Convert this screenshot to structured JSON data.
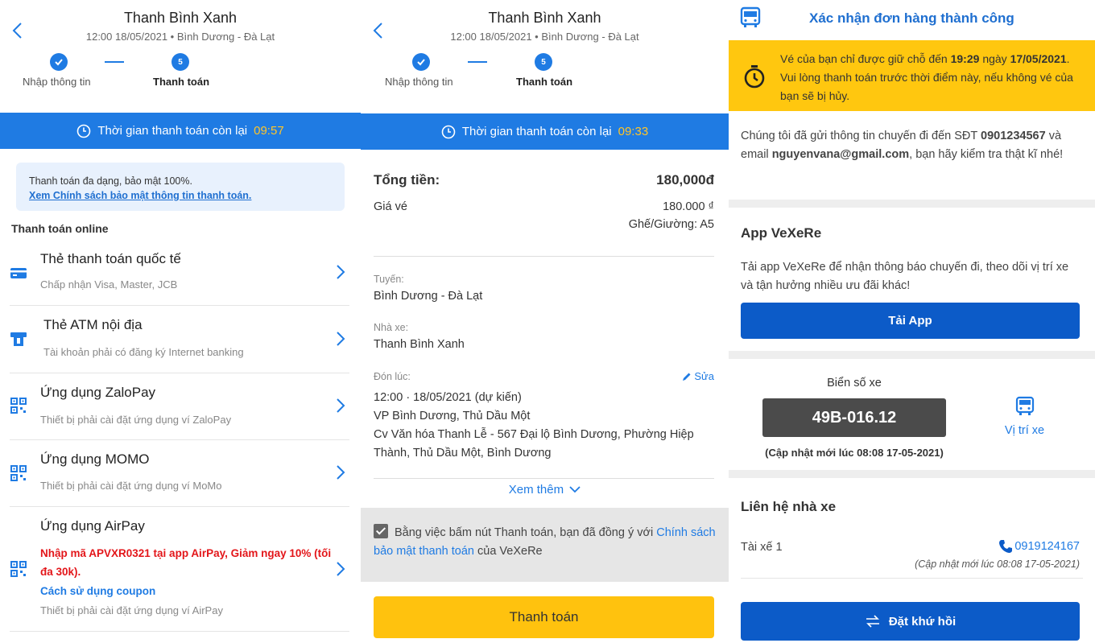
{
  "panel1": {
    "header": {
      "title": "Thanh Bình Xanh",
      "subtitle": "12:00 18/05/2021 • Bình Dương - Đà Lạt",
      "step1_label": "Nhập thông tin",
      "step2_label": "Thanh toán",
      "step2_number": "5"
    },
    "timer": {
      "label": "Thời gian thanh toán còn lại",
      "value": "09:57"
    },
    "info": {
      "text": "Thanh toán đa dạng, bảo mật 100%.",
      "link": "Xem Chính sách bảo mật thông tin thanh toán."
    },
    "section_title": "Thanh toán online",
    "methods": [
      {
        "name": "Thẻ thanh toán quốc tế",
        "desc": "Chấp nhận Visa, Master, JCB"
      },
      {
        "name": "Thẻ ATM nội địa",
        "desc": "Tài khoản phải có đăng ký Internet banking"
      },
      {
        "name": "Ứng dụng ZaloPay",
        "desc": "Thiết bị phải cài đặt ứng dụng ví ZaloPay"
      },
      {
        "name": "Ứng dụng MOMO",
        "desc": "Thiết bị phải cài đặt ứng dụng ví MoMo"
      },
      {
        "name": "Ứng dụng AirPay",
        "promo": "Nhập mã APVXR0321 tại app AirPay, Giảm ngay 10% (tối đa 30k).",
        "howto": "Cách sử dụng coupon",
        "desc": "Thiết bị phải cài đặt ứng dụng ví AirPay"
      }
    ]
  },
  "panel2": {
    "header": {
      "title": "Thanh Bình Xanh",
      "subtitle": "12:00 18/05/2021 • Bình Dương - Đà Lạt",
      "step1_label": "Nhập thông tin",
      "step2_label": "Thanh toán",
      "step2_number": "5"
    },
    "timer": {
      "label": "Thời gian thanh toán còn lại",
      "value": "09:33"
    },
    "total_label": "Tổng tiền:",
    "total_value": "180,000đ",
    "ticket_label": "Giá vé",
    "ticket_value": "180.000 ₫",
    "seat": "Ghế/Giường: A5",
    "route_label": "Tuyến:",
    "route_value": "Bình Dương - Đà Lạt",
    "operator_label": "Nhà xe:",
    "operator_value": "Thanh Bình Xanh",
    "pickup_label": "Đón lúc:",
    "edit_label": "Sửa",
    "pickup_time": "12:00 · 18/05/2021 (dự kiến)",
    "pickup_place": "VP Bình Dương, Thủ Dầu Một",
    "pickup_address": "Cv Văn hóa Thanh Lễ - 567 Đại lộ Bình Dương, Phường Hiệp Thành, Thủ Dầu Một, Bình Dương",
    "see_more": "Xem thêm",
    "agree_prefix": "Bằng việc bấm nút Thanh toán, bạn đã đồng ý với",
    "agree_link": "Chính sách bảo mật thanh toán",
    "agree_suffix": "của VeXeRe",
    "pay_button": "Thanh toán"
  },
  "panel3": {
    "title": "Xác nhận đơn hàng thành công",
    "warn_1": "Vé của bạn chỉ được giữ chỗ đến",
    "warn_time": "19:29",
    "warn_2": "ngày",
    "warn_date": "17/05/2021",
    "warn_3": ". Vui lòng thanh toán trước thời điểm này, nếu không vé của bạn sẽ bị hủy.",
    "sent_1": "Chúng tôi đã gửi thông tin chuyến đi đến SĐT",
    "phone": "0901234567",
    "sent_2": "và email",
    "email": "nguyenvana@gmail.com",
    "sent_3": ", bạn hãy kiểm tra thật kĩ nhé!",
    "app_title": "App VeXeRe",
    "app_desc": "Tải app VeXeRe để nhận thông báo chuyến đi, theo dõi vị trí xe và tận hưởng nhiều ưu đãi khác!",
    "app_button": "Tải App",
    "plate_label": "Biển số xe",
    "plate": "49B-016.12",
    "plate_updated": "(Cập nhật mới lúc 08:08 17-05-2021)",
    "location_label": "Vị trí xe",
    "contact_title": "Liên hệ nhà xe",
    "driver_label": "Tài xế 1",
    "driver_phone": "0919124167",
    "driver_updated": "(Cập nhật mới lúc 08:08 17-05-2021)",
    "return_button": "Đặt khứ hồi"
  },
  "colors": {
    "primary": "#1f7be3",
    "dark_blue": "#0c5bc8",
    "yellow": "#ffc20e",
    "timer_value": "#ffc528",
    "promo_red": "#e3161a"
  }
}
